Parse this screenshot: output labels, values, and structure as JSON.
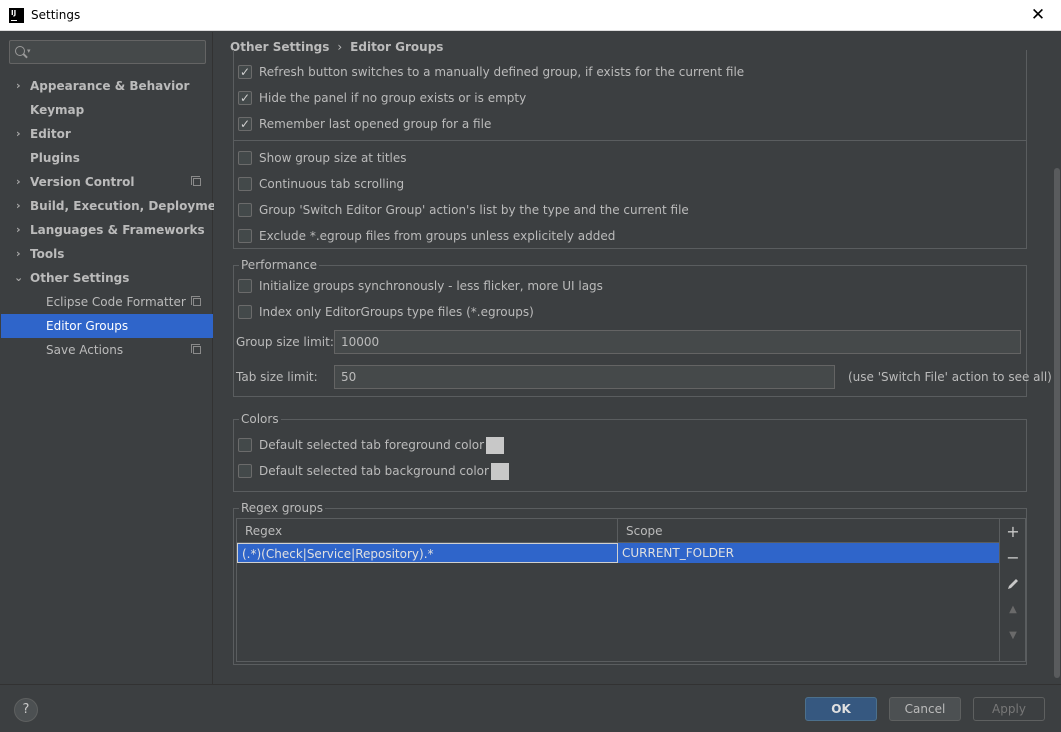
{
  "window": {
    "title": "Settings",
    "close_glyph": "✕"
  },
  "search": {
    "placeholder": ""
  },
  "sidebar": {
    "items": [
      {
        "label": "Appearance & Behavior",
        "expandable": true,
        "bold": true
      },
      {
        "label": "Keymap",
        "expandable": false,
        "bold": true
      },
      {
        "label": "Editor",
        "expandable": true,
        "bold": true
      },
      {
        "label": "Plugins",
        "expandable": false,
        "bold": true
      },
      {
        "label": "Version Control",
        "expandable": true,
        "bold": true,
        "project_icon": true
      },
      {
        "label": "Build, Execution, Deployment",
        "expandable": true,
        "bold": true
      },
      {
        "label": "Languages & Frameworks",
        "expandable": true,
        "bold": true
      },
      {
        "label": "Tools",
        "expandable": true,
        "bold": true
      },
      {
        "label": "Other Settings",
        "expanded": true,
        "bold": true
      },
      {
        "label": "Eclipse Code Formatter",
        "child": true,
        "project_icon": true
      },
      {
        "label": "Editor Groups",
        "child": true,
        "selected": true
      },
      {
        "label": "Save Actions",
        "child": true,
        "project_icon": true
      }
    ]
  },
  "breadcrumb": {
    "parent": "Other Settings",
    "separator": "›",
    "current": "Editor Groups"
  },
  "general": {
    "checks": [
      {
        "label": "Refresh button switches to a manually defined group, if exists for the current file",
        "checked": true
      },
      {
        "label": "Hide the panel if no group exists or is empty",
        "checked": true
      },
      {
        "label": "Remember last opened group for a file",
        "checked": true
      },
      {
        "label": "Show group size at titles",
        "checked": false
      },
      {
        "label": "Continuous tab scrolling",
        "checked": false
      },
      {
        "label": "Group 'Switch Editor Group' action's list by the type and the current file",
        "checked": false
      },
      {
        "label": "Exclude *.egroup files from groups unless explicitely added",
        "checked": false
      }
    ]
  },
  "performance": {
    "title": "Performance",
    "checks": [
      {
        "label": "Initialize groups synchronously - less flicker, more UI lags",
        "checked": false
      },
      {
        "label": "Index only EditorGroups type files (*.egroups)",
        "checked": false
      }
    ],
    "group_size_label": "Group size limit:",
    "group_size_value": "10000",
    "tab_size_label": "Tab size limit:",
    "tab_size_value": "50",
    "tab_size_hint": "(use 'Switch File' action to see all)"
  },
  "colors": {
    "title": "Colors",
    "checks": [
      {
        "label": "Default selected tab foreground color",
        "checked": false,
        "swatch": "#c8c8c8"
      },
      {
        "label": "Default selected tab background color",
        "checked": false,
        "swatch": "#c8c8c8"
      }
    ]
  },
  "regex": {
    "title": "Regex groups",
    "columns": [
      "Regex",
      "Scope"
    ],
    "rows": [
      {
        "regex": "(.*)(Check|Service|Repository).*",
        "scope": "CURRENT_FOLDER"
      }
    ],
    "toolbar": [
      "add-icon",
      "remove-icon",
      "edit-icon",
      "move-up-icon",
      "move-down-icon"
    ]
  },
  "footer": {
    "help": "?",
    "ok": "OK",
    "cancel": "Cancel",
    "apply": "Apply"
  },
  "colors_theme": {
    "accent": "#2f65ca",
    "primary_button": "#365880",
    "background": "#3c3f41"
  }
}
